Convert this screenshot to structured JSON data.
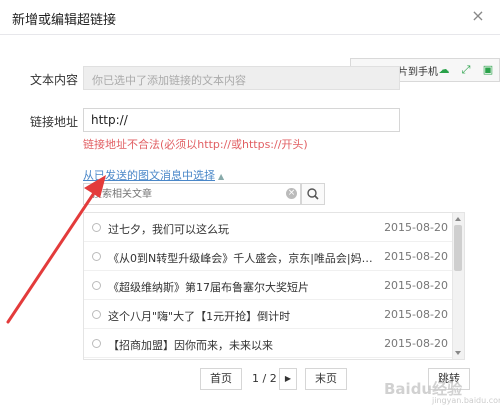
{
  "dialog": {
    "title": "新增或编辑超链接",
    "close": "×"
  },
  "form": {
    "text_label": "文本内容",
    "text_value": "你已选中了添加链接的文本内容",
    "url_label": "链接地址",
    "url_value": "http://",
    "error": "链接地址不合法(必须以http://或https://开头)"
  },
  "toolbar": {
    "send_label": "发送图片到手机",
    "icons": [
      "cloud-icon",
      "expand-icon",
      "save-icon"
    ]
  },
  "picker": {
    "link_label": "从已发送的图文消息中选择",
    "search_placeholder": "搜索相关文章"
  },
  "articles": [
    {
      "title": "过七夕，我们可以这么玩",
      "date": "2015-08-20"
    },
    {
      "title": "《从0到N转型升级峰会》千人盛会，京东|唯品会|妈咪快美|美...",
      "date": "2015-08-20"
    },
    {
      "title": "《超级维纳斯》第17届布鲁塞尔大奖短片",
      "date": "2015-08-20"
    },
    {
      "title": "这个八月\"嗨\"大了【1元开抢】倒计时",
      "date": "2015-08-20"
    },
    {
      "title": "【招商加盟】因你而来，未来以来",
      "date": "2015-08-20"
    }
  ],
  "pagination": {
    "first": "首页",
    "current": "1 / 2",
    "next_arrow": "▶",
    "last": "末页",
    "jump": "跳转"
  },
  "watermark": {
    "text": "Baidu经验",
    "sub": "jingyan.baidu.com"
  }
}
